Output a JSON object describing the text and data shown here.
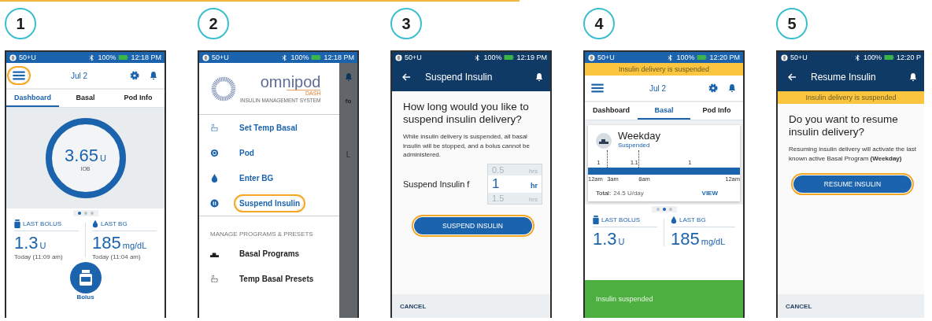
{
  "steps": [
    {
      "number": "1",
      "screen": {
        "kind": "home",
        "status": {
          "reservoir": "50+U",
          "battery": "100%",
          "time": "12:18 PM"
        },
        "header": {
          "date": "Jul 2",
          "menu_highlighted": true
        },
        "tabs": [
          {
            "label": "Dashboard",
            "selected": true
          },
          {
            "label": "Basal",
            "selected": false
          },
          {
            "label": "Pod Info",
            "selected": false
          }
        ],
        "iob": {
          "value": "3.65",
          "unit": "U",
          "label": "IOB"
        },
        "pager": [
          {
            "selected": true
          },
          {
            "selected": false
          },
          {
            "selected": false
          }
        ],
        "last_bolus": {
          "label": "LAST BOLUS",
          "value": "1.3",
          "unit": "U",
          "time": "Today (11:09 am)"
        },
        "last_bg": {
          "label": "LAST BG",
          "value": "185",
          "unit": "mg/dL",
          "time": "Today (11:04 am)"
        },
        "bolus_button": {
          "label": "Bolus"
        }
      }
    },
    {
      "number": "2",
      "screen": {
        "kind": "menu",
        "status": {
          "reservoir": "50+U",
          "battery": "100%",
          "time": "12:18 PM"
        },
        "logo": {
          "brand": "omnipod",
          "product": "DASH",
          "tagline": "INSULIN MANAGEMENT SYSTEM"
        },
        "items": [
          {
            "kind": "temp",
            "label": "Set Temp Basal",
            "highlighted": false
          },
          {
            "kind": "pod",
            "label": "Pod",
            "highlighted": false
          },
          {
            "kind": "drop",
            "label": "Enter BG",
            "highlighted": false
          },
          {
            "kind": "pause",
            "label": "Suspend Insulin",
            "highlighted": true
          }
        ],
        "section": "MANAGE PROGRAMS & PRESETS",
        "section_items": [
          {
            "kind": "program",
            "label": "Basal Programs"
          },
          {
            "kind": "temp",
            "label": "Temp Basal Presets"
          }
        ],
        "behind": {
          "tab_fragment": "fo",
          "text_fragment": "L"
        }
      }
    },
    {
      "number": "3",
      "screen": {
        "kind": "suspend",
        "status": {
          "reservoir": "50+U",
          "battery": "100%",
          "time": "12:19 PM"
        },
        "title": "Suspend Insulin",
        "question": "How long would you like to suspend insulin delivery?",
        "body": "While insulin delivery is suspended, all basal insulin will be stopped, and a bolus cannot be administered.",
        "picker_label": "Suspend Insulin f",
        "options": [
          {
            "value": "0.5",
            "unit": "hrs",
            "selected": false
          },
          {
            "value": "1",
            "unit": "hr",
            "selected": true
          },
          {
            "value": "1.5",
            "unit": "hrs",
            "selected": false
          }
        ],
        "button": {
          "label": "SUSPEND INSULIN",
          "highlighted": true
        },
        "cancel": "CANCEL"
      }
    },
    {
      "number": "4",
      "screen": {
        "kind": "home",
        "status": {
          "reservoir": "50+U",
          "battery": "100%",
          "time": "12:20 PM"
        },
        "banner": "Insulin delivery is suspended",
        "header": {
          "date": "Jul 2",
          "menu_highlighted": false
        },
        "tabs": [
          {
            "label": "Dashboard",
            "selected": false
          },
          {
            "label": "Basal",
            "selected": true
          },
          {
            "label": "Pod Info",
            "selected": false
          }
        ],
        "basal_card": {
          "name": "Weekday",
          "status": "Suspended",
          "rates": [
            "1",
            "1.1",
            "1"
          ],
          "times": [
            "12am",
            "3am",
            "8am",
            "12am"
          ],
          "total_label": "Total:",
          "total": "24.5 U/day",
          "view": "VIEW"
        },
        "pager": [
          {
            "selected": false
          },
          {
            "selected": true
          },
          {
            "selected": false
          }
        ],
        "last_bolus": {
          "label": "LAST BOLUS",
          "value": "1.3",
          "unit": "U"
        },
        "last_bg": {
          "label": "LAST BG",
          "value": "185",
          "unit": "mg/dL"
        },
        "toast": "Insulin suspended"
      }
    },
    {
      "number": "5",
      "screen": {
        "kind": "resume",
        "status": {
          "reservoir": "50+U",
          "battery": "100%",
          "time": "12:20 P"
        },
        "title": "Resume Insulin",
        "banner": "Insulin delivery is suspended",
        "question": "Do you want to resume insulin delivery?",
        "body": "Resuming insulin delivery will activate the last known active Basal Program **(Weekday)**",
        "button": {
          "label": "RESUME INSULIN",
          "highlighted": true
        },
        "cancel": "CANCEL"
      }
    }
  ]
}
